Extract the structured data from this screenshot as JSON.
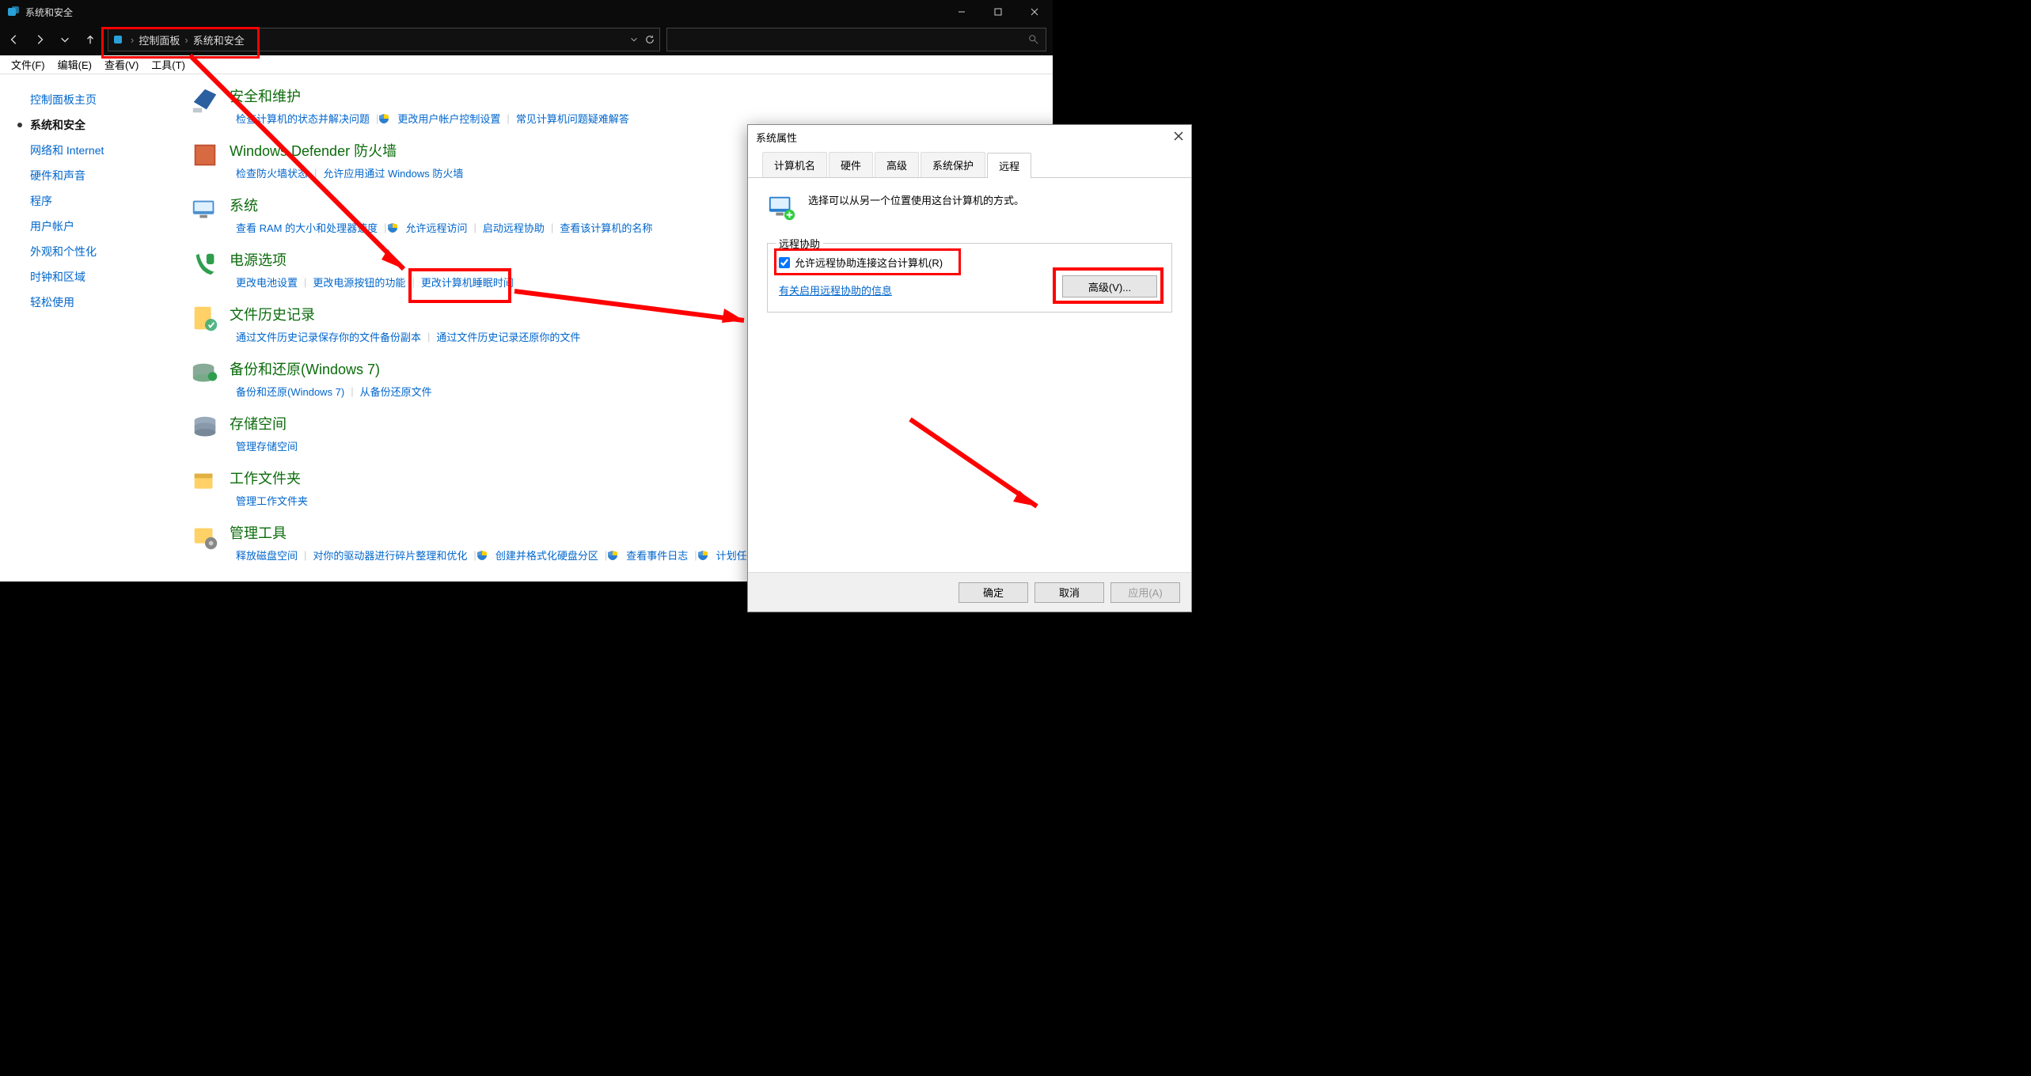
{
  "window": {
    "title": "系统和安全",
    "breadcrumb": {
      "root": "控制面板",
      "sub": "系统和安全"
    },
    "menus": {
      "file": "文件(F)",
      "edit": "编辑(E)",
      "view": "查看(V)",
      "tools": "工具(T)"
    }
  },
  "sidebar": {
    "items": [
      {
        "label": "控制面板主页",
        "active": false
      },
      {
        "label": "系统和安全",
        "active": true
      },
      {
        "label": "网络和 Internet",
        "active": false
      },
      {
        "label": "硬件和声音",
        "active": false
      },
      {
        "label": "程序",
        "active": false
      },
      {
        "label": "用户帐户",
        "active": false
      },
      {
        "label": "外观和个性化",
        "active": false
      },
      {
        "label": "时钟和区域",
        "active": false
      },
      {
        "label": "轻松使用",
        "active": false
      }
    ]
  },
  "categories": [
    {
      "head": "安全和维护",
      "links": [
        {
          "t": "检查计算机的状态并解决问题"
        },
        {
          "t": "更改用户帐户控制设置",
          "shield": true
        },
        {
          "t": "常见计算机问题疑难解答"
        }
      ]
    },
    {
      "head": "Windows Defender 防火墙",
      "links": [
        {
          "t": "检查防火墙状态"
        },
        {
          "t": "允许应用通过 Windows 防火墙"
        }
      ]
    },
    {
      "head": "系统",
      "links": [
        {
          "t": "查看 RAM 的大小和处理器速度"
        },
        {
          "t": "允许远程访问",
          "shield": true
        },
        {
          "t": "启动远程协助"
        },
        {
          "t": "查看该计算机的名称"
        }
      ]
    },
    {
      "head": "电源选项",
      "links": [
        {
          "t": "更改电池设置"
        },
        {
          "t": "更改电源按钮的功能"
        },
        {
          "t": "更改计算机睡眠时间"
        }
      ]
    },
    {
      "head": "文件历史记录",
      "links": [
        {
          "t": "通过文件历史记录保存你的文件备份副本"
        },
        {
          "t": "通过文件历史记录还原你的文件"
        }
      ]
    },
    {
      "head": "备份和还原(Windows 7)",
      "links": [
        {
          "t": "备份和还原(Windows 7)"
        },
        {
          "t": "从备份还原文件"
        }
      ]
    },
    {
      "head": "存储空间",
      "links": [
        {
          "t": "管理存储空间"
        }
      ]
    },
    {
      "head": "工作文件夹",
      "links": [
        {
          "t": "管理工作文件夹"
        }
      ]
    },
    {
      "head": "管理工具",
      "links": [
        {
          "t": "释放磁盘空间"
        },
        {
          "t": "对你的驱动器进行碎片整理和优化"
        },
        {
          "t": "创建并格式化硬盘分区",
          "shield": true
        },
        {
          "t": "查看事件日志",
          "shield": true
        },
        {
          "t": "计划任务",
          "shield": true
        }
      ]
    }
  ],
  "dialog": {
    "title": "系统属性",
    "tabs": {
      "t0": "计算机名",
      "t1": "硬件",
      "t2": "高级",
      "t3": "系统保护",
      "t4": "远程"
    },
    "intro": "选择可以从另一个位置使用这台计算机的方式。",
    "groupTitle": "远程协助",
    "checkbox": "允许远程协助连接这台计算机(R)",
    "helplink": "有关启用远程协助的信息",
    "advanced": "高级(V)...",
    "ok": "确定",
    "cancel": "取消",
    "apply": "应用(A)"
  }
}
